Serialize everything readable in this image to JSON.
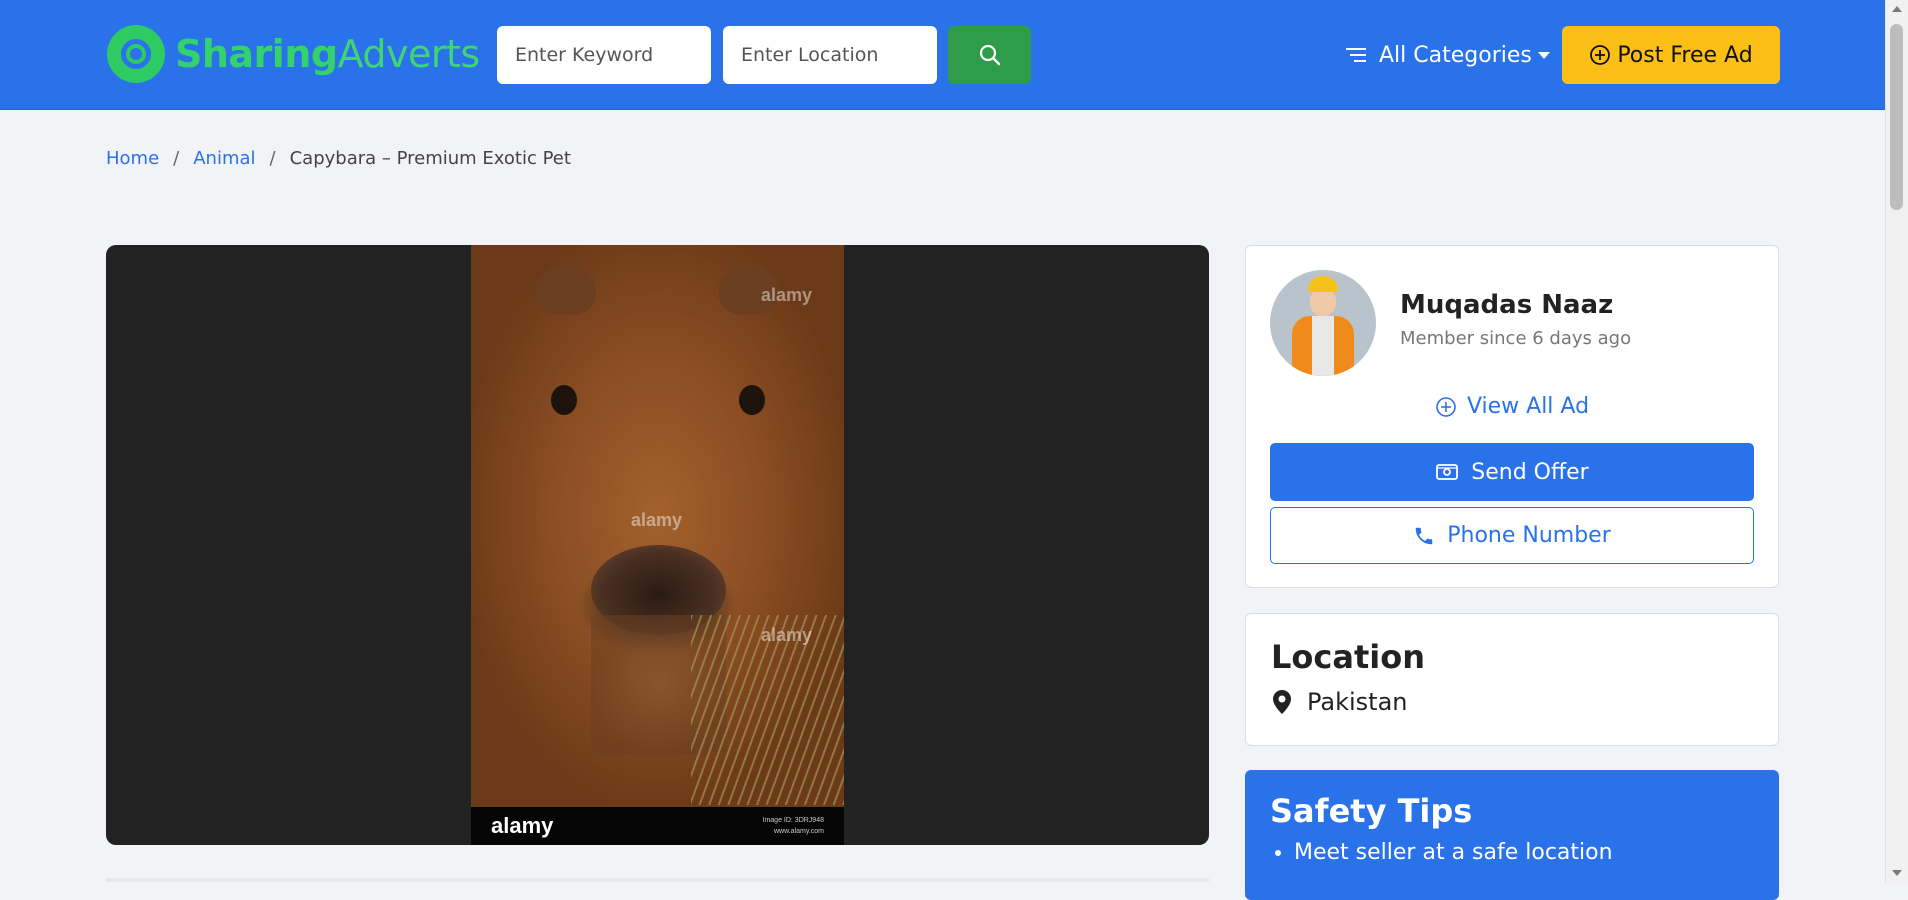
{
  "header": {
    "logo": {
      "part1": "Sharing",
      "part2": "Adverts"
    },
    "keyword_placeholder": "Enter Keyword",
    "location_placeholder": "Enter Location",
    "categories_label": "All Categories",
    "post_ad_label": "Post Free Ad",
    "colors": {
      "bar": "#2a72ea",
      "search": "#2e9c48",
      "post": "#fcbf15",
      "logo": "#33d26a"
    }
  },
  "breadcrumb": {
    "items": [
      "Home",
      "Animal"
    ],
    "current": "Capybara – Premium Exotic Pet"
  },
  "gallery": {
    "watermark": "alamy",
    "strip_brand": "alamy",
    "image_id": "Image ID: 3DRJ948",
    "site": "www.alamy.com"
  },
  "seller": {
    "name": "Muqadas Naaz",
    "member_since": "Member since 6 days ago",
    "view_all_label": "View All Ad",
    "send_offer_label": "Send Offer",
    "phone_label": "Phone Number"
  },
  "location": {
    "title": "Location",
    "value": "Pakistan"
  },
  "safety": {
    "title": "Safety Tips",
    "tips": [
      "Meet seller at a safe location"
    ]
  }
}
